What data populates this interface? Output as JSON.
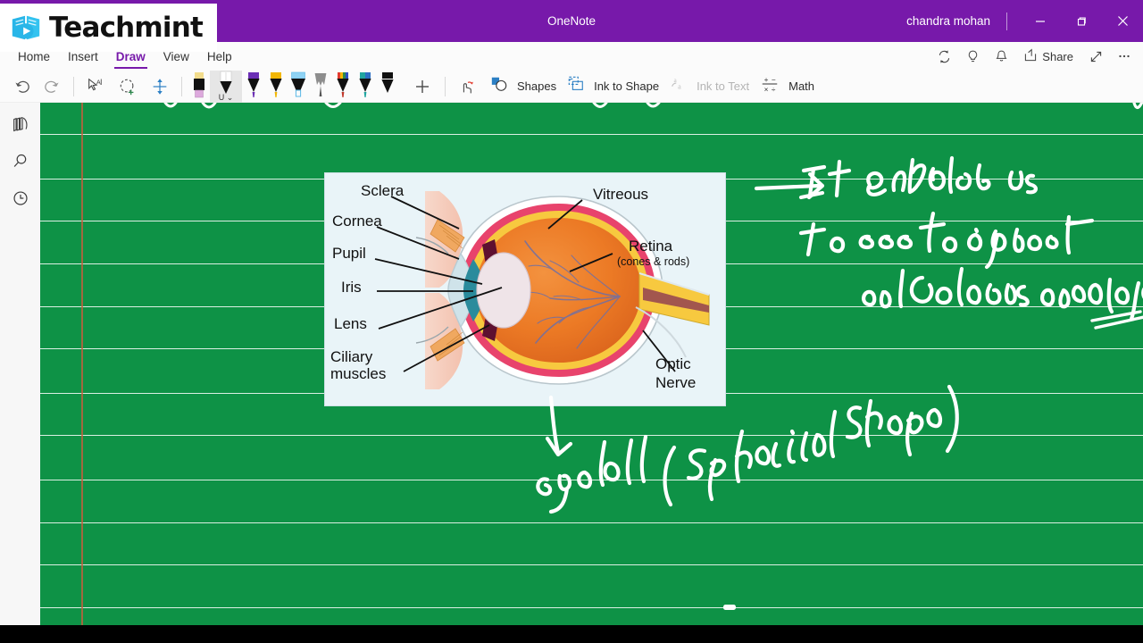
{
  "window": {
    "app_title": "OneNote",
    "user": "chandra mohan",
    "minimize": "−",
    "maximize": "❐",
    "close": "✕",
    "brand_color": "#7719aa"
  },
  "brand": {
    "name": "Teachmint",
    "logo_icon": "open-book-play-icon",
    "logo_blue": "#29b6e8"
  },
  "ribbon": {
    "tabs": [
      {
        "label": "Home",
        "active": false
      },
      {
        "label": "Insert",
        "active": false
      },
      {
        "label": "Draw",
        "active": true
      },
      {
        "label": "View",
        "active": false
      },
      {
        "label": "Help",
        "active": false
      }
    ],
    "right_actions": [
      {
        "label": "",
        "icon": "sync-icon"
      },
      {
        "label": "",
        "icon": "lightbulb-icon"
      },
      {
        "label": "",
        "icon": "bell-icon"
      },
      {
        "label": "Share",
        "icon": "share-icon"
      },
      {
        "label": "",
        "icon": "expand-arrow-icon"
      },
      {
        "label": "",
        "icon": "ellipsis-icon"
      }
    ],
    "share_label": "Share"
  },
  "toolbar": {
    "undo": "Undo",
    "redo": "Redo",
    "lasso_select": "Lasso Select",
    "lasso_add": "Add Selection",
    "insert_space": "Insert Space",
    "add_pen": "+",
    "ink_replay": "Ink Replay",
    "shapes_label": "Shapes",
    "ink_to_shape_label": "Ink to Shape",
    "ink_to_text_label": "Ink to Text",
    "math_label": "Math",
    "pens": [
      {
        "name": "eraser",
        "top": "#f2dc8c",
        "body": "#111111",
        "tip": "#dda9dd",
        "selected": false
      },
      {
        "name": "pen-white",
        "top": "#ffffff",
        "body": "#111111",
        "tip": "#ffffff",
        "selected": true,
        "sub": "U"
      },
      {
        "name": "pen-purple",
        "top": "#6b2fb5",
        "body": "#111111",
        "tip": "#6b2fb5",
        "selected": false
      },
      {
        "name": "pen-yellow",
        "top": "#f2b705",
        "body": "#111111",
        "tip": "#f2b705",
        "selected": false
      },
      {
        "name": "highlighter-blue",
        "top": "#8fd3f4",
        "body": "#111111",
        "tip": "#8fd3f4",
        "selected": false
      },
      {
        "name": "pencil-gray",
        "top": "#8d8d8d",
        "body": "#8d8d8d",
        "tip": "#555555",
        "selected": false
      },
      {
        "name": "pen-rainbow",
        "top": "#ff0000",
        "body": "#111111",
        "tip": "#c0392b",
        "selected": false
      },
      {
        "name": "pen-teal",
        "top": "#1fa5a0",
        "body": "#111111",
        "tip": "#1fa5a0",
        "selected": false
      },
      {
        "name": "pen-black",
        "top": "#111111",
        "body": "#111111",
        "tip": "#111111",
        "selected": false
      }
    ]
  },
  "sidebar": {
    "items": [
      {
        "label": "Notebooks",
        "icon": "notebooks-icon"
      },
      {
        "label": "Search",
        "icon": "search-icon"
      },
      {
        "label": "Recent Notes",
        "icon": "clock-icon"
      }
    ]
  },
  "page": {
    "background_color": "#0e9246",
    "rule_color": "#ffffff",
    "margin_color": "#d25a3c",
    "rule_positions": [
      35,
      85,
      132,
      180,
      228,
      275,
      325,
      372,
      422,
      470,
      517,
      565
    ]
  },
  "diagram": {
    "title": "human-eye-cross-section",
    "labels_left": [
      {
        "text": "Sclera"
      },
      {
        "text": "Cornea"
      },
      {
        "text": "Pupil"
      },
      {
        "text": "Iris"
      },
      {
        "text": "Lens"
      },
      {
        "text": "Ciliary"
      },
      {
        "text": "muscles"
      }
    ],
    "labels_right": [
      {
        "text": "Vitreous",
        "sub": ""
      },
      {
        "text": "Retina",
        "sub": "(cones & rods)"
      },
      {
        "text": "Optic",
        "sub": ""
      },
      {
        "text": "Nerve",
        "sub": ""
      }
    ]
  },
  "handwriting": {
    "ink_color": "#ffffff",
    "notes": [
      {
        "text": "→ It enables us",
        "line": 1
      },
      {
        "text": "to see the object",
        "line": 2
      },
      {
        "text": "and Colours around us",
        "line": 3
      },
      {
        "text": "eye ball (Spherical shape)",
        "line": 4
      }
    ]
  }
}
